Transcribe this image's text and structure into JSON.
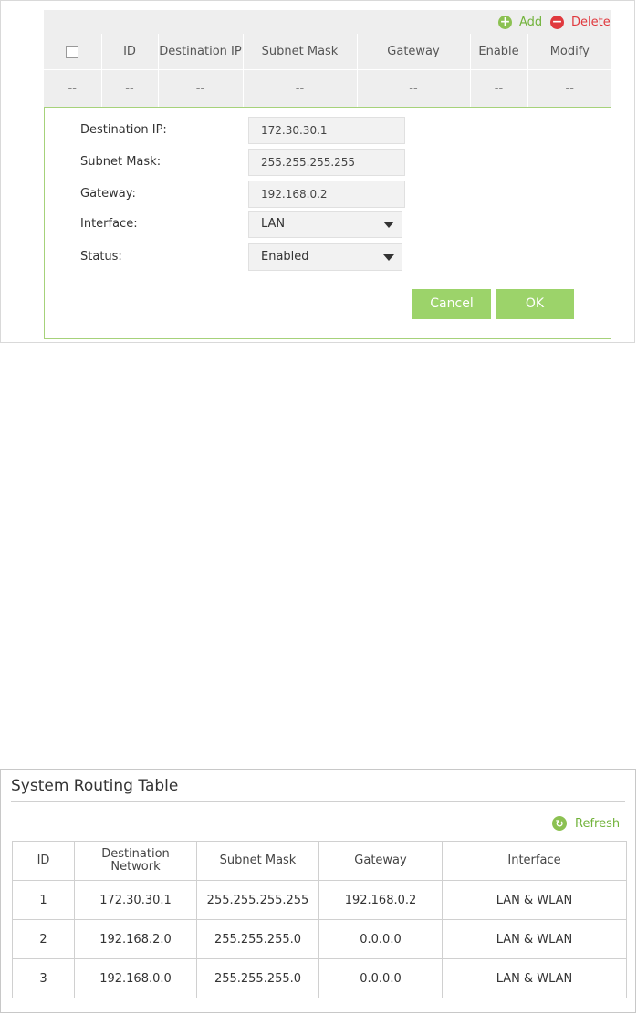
{
  "toolbar": {
    "add_label": "Add",
    "delete_label": "Delete",
    "add_icon": "plus-circle-icon",
    "delete_icon": "minus-circle-icon"
  },
  "static_routes": {
    "columns": [
      "ID",
      "Destination IP",
      "Subnet Mask",
      "Gateway",
      "Enable",
      "Modify"
    ],
    "empty_row": [
      "--",
      "--",
      "--",
      "--",
      "--",
      "--",
      "--"
    ]
  },
  "edit_form": {
    "destination_ip": {
      "label": "Destination IP:",
      "value": "172.30.30.1"
    },
    "subnet_mask": {
      "label": "Subnet Mask:",
      "value": "255.255.255.255"
    },
    "gateway": {
      "label": "Gateway:",
      "value": "192.168.0.2"
    },
    "interface": {
      "label": "Interface:",
      "value": "LAN"
    },
    "status": {
      "label": "Status:",
      "value": "Enabled"
    },
    "cancel_label": "Cancel",
    "ok_label": "OK"
  },
  "system_routing": {
    "title": "System Routing Table",
    "refresh_label": "Refresh",
    "refresh_icon": "refresh-icon",
    "columns": [
      "ID",
      "Destination Network",
      "Subnet Mask",
      "Gateway",
      "Interface"
    ],
    "rows": [
      [
        "1",
        "172.30.30.1",
        "255.255.255.255",
        "192.168.0.2",
        "LAN & WLAN"
      ],
      [
        "2",
        "192.168.2.0",
        "255.255.255.0",
        "0.0.0.0",
        "LAN & WLAN"
      ],
      [
        "3",
        "192.168.0.0",
        "255.255.255.0",
        "0.0.0.0",
        "LAN & WLAN"
      ]
    ]
  },
  "colors": {
    "accent_green": "#8cc152",
    "delete_red": "#e0393e",
    "button_green": "#9cd36a"
  }
}
